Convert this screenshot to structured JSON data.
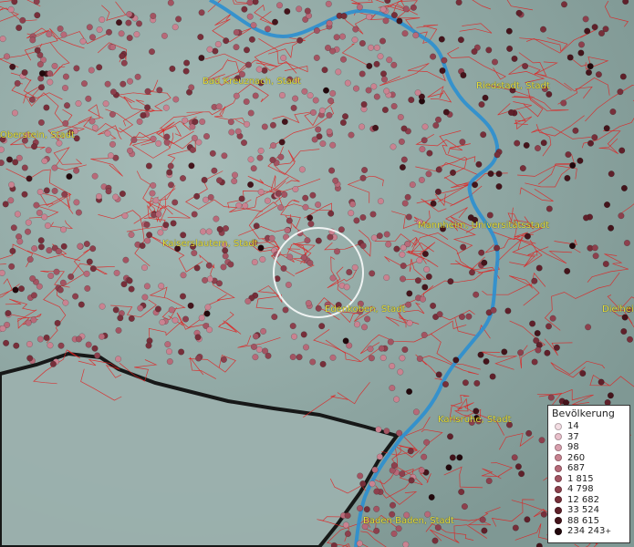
{
  "map": {
    "cities": [
      {
        "id": "bad-kreuznach",
        "label": "Bad Kreuznach, Stadt"
      },
      {
        "id": "idar-oberstein",
        "label": "Oberstein, Stadt"
      },
      {
        "id": "riedstadt",
        "label": "Riedstadt, Stadt"
      },
      {
        "id": "mannheim",
        "label": "Mannheim, Universitätsstadt"
      },
      {
        "id": "kaiserslautern",
        "label": "Kaiserslautern, Stadt"
      },
      {
        "id": "edenkoben",
        "label": "Edenkoben, Stadt"
      },
      {
        "id": "dielheim",
        "label": "Dielhei"
      },
      {
        "id": "karlsruhe",
        "label": "Karlsruhe, Stadt"
      },
      {
        "id": "baden-baden",
        "label": "Baden-Baden, Stadt"
      }
    ],
    "colors": {
      "boundary": "#e02020",
      "river": "#2b8fd0",
      "terrain": "#8fa7a4",
      "label": "#e8e03a"
    }
  },
  "legend": {
    "title": "Bevölkerung",
    "items": [
      {
        "label": "14",
        "color": "#f3dde3"
      },
      {
        "label": "37",
        "color": "#e9c0cb"
      },
      {
        "label": "98",
        "color": "#d9a0ae"
      },
      {
        "label": "260",
        "color": "#c98391"
      },
      {
        "label": "687",
        "color": "#b76a79"
      },
      {
        "label": "1 815",
        "color": "#a35462"
      },
      {
        "label": "4 798",
        "color": "#8d404d"
      },
      {
        "label": "12 682",
        "color": "#772f3a"
      },
      {
        "label": "33 524",
        "color": "#5f202a"
      },
      {
        "label": "88 615",
        "color": "#44141b"
      },
      {
        "label": "234 243",
        "color": "#22080c"
      }
    ],
    "overflow_mark": "+"
  }
}
